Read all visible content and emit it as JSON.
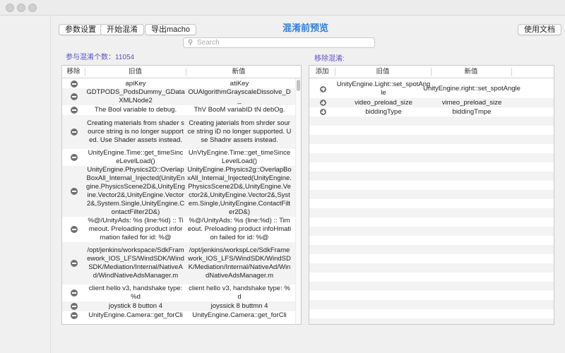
{
  "toolbar": {
    "params_label": "参数设置",
    "start_label": "开始混淆",
    "export_label": "导出macho",
    "docs_label": "使用文档"
  },
  "page_title": "混淆前预览",
  "search": {
    "placeholder": "Search"
  },
  "left": {
    "count_prefix": "参与混淆个数：",
    "count_value": "11054",
    "headers": {
      "action": "移除",
      "old": "旧值",
      "new": "新值"
    },
    "rows": [
      {
        "old": "apiKey",
        "new": "atiKey"
      },
      {
        "old": "GDTPODS_PodsDummy_GDataXMLNode2",
        "new": "OUAlgorithmGrayscaleDissolve_D_"
      },
      {
        "old": "The Bool variable to debug.",
        "new": "ThV BooM variabID tN debOg."
      },
      {
        "old": "Creating materials from shader source string is no longer supported. Use Shader assets instead.",
        "new": "Creating jaterials from shrder source string iD no longer supported. Use Shadnr assets instead."
      },
      {
        "old": "UnityEngine.Time::get_timeSinceLevelLoad()",
        "new": "UnVtyEngine.Time::get_timeSinceLevelLoad()"
      },
      {
        "old": "UnityEngine.Physics2D::OverlapBoxAll_Internal_Injected(UnityEngine.PhysicsScene2D&,UnityEngine.Vector2&,UnityEngine.Vector2&,System.Single,UnityEngine.ContactFilter2D&)",
        "new": "UnityEngine.Physics2g::OverlapBoxAll_Internal_Injected(UnityEngine.PhysicsScene2D&,UnityEngine.Vector2&,UnityEngine.Vector2&,System.Single,UnityEngine.ContactFilter2D&)"
      },
      {
        "old": "%@/UnityAds: %s (line:%d) :: Timeout. Preloading product information failed for id: %@",
        "new": "%@/UnityAds: %s (line:%d) :: Timeout. Preloading product infoHmation failed for id: %@"
      },
      {
        "old": "/opt/jenkins/workspace/SdkFramework_IOS_LFS/WindSDK/WindSDK/Mediation/Internal/NativeAd/WindNativeAdsManager.m",
        "new": "/opt/jenkins/workspLce/SdkFramework_IOS_LFS/WindSDK/WindSDK/Mediation/Internal/NativeAd/WindNativeAdsManager.m"
      },
      {
        "old": "client hello v3, handshake type: %d",
        "new": "client hello v3, handshake type: %d"
      },
      {
        "old": "joystick 8 button 4",
        "new": "joyssick 8 buttmn 4"
      },
      {
        "old": "UnityEngine.Camera::get_forCli",
        "new": "UnityEngine.Camera::get_forCli"
      }
    ]
  },
  "right": {
    "title": "移除混淆:",
    "headers": {
      "action": "添加",
      "old": "旧值",
      "new": "新值"
    },
    "rows": [
      {
        "old": "UnityEngine.Light::set_spotAngle",
        "new": "UnityEngine.right::set_spotAngle"
      },
      {
        "old": "video_preload_size",
        "new": "vimeo_preload_size"
      },
      {
        "old": "biddingType",
        "new": "biddingTmpe"
      }
    ]
  },
  "colors": {
    "accent": "#2f7fd6",
    "label": "#5b4fc9"
  },
  "icons": {
    "remove": "minus-circle-icon",
    "add": "plus-circle-icon",
    "search": "magnifier-icon"
  }
}
